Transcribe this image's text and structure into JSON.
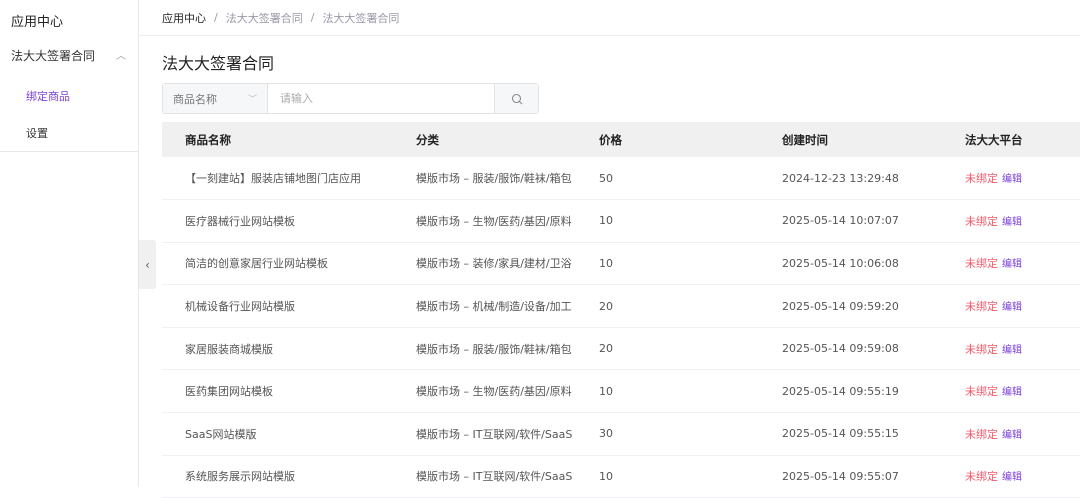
{
  "sidebar": {
    "title": "应用中心",
    "group": "法大大签署合同",
    "items": [
      {
        "label": "绑定商品",
        "active": true
      },
      {
        "label": "设置",
        "active": false
      }
    ]
  },
  "breadcrumb": [
    "应用中心",
    "法大大签署合同",
    "法大大签署合同"
  ],
  "page_title": "法大大签署合同",
  "search": {
    "field": "商品名称",
    "placeholder": "请输入"
  },
  "table": {
    "headers": [
      "商品名称",
      "分类",
      "价格",
      "创建时间",
      "法大大平台"
    ],
    "rows": [
      [
        "【一刻建站】服装店铺地图门店应用",
        "模版市场 – 服装/服饰/鞋袜/箱包",
        "50",
        "2024-12-23 13:29:48",
        "未绑定",
        "编辑"
      ],
      [
        "医疗器械行业网站模板",
        "模版市场 – 生物/医药/基因/原料",
        "10",
        "2025-05-14 10:07:07",
        "未绑定",
        "编辑"
      ],
      [
        "简洁的创意家居行业网站模板",
        "模版市场 – 装修/家具/建材/卫浴",
        "10",
        "2025-05-14 10:06:08",
        "未绑定",
        "编辑"
      ],
      [
        "机械设备行业网站模版",
        "模版市场 – 机械/制造/设备/加工",
        "20",
        "2025-05-14 09:59:20",
        "未绑定",
        "编辑"
      ],
      [
        "家居服装商城模版",
        "模版市场 – 服装/服饰/鞋袜/箱包",
        "20",
        "2025-05-14 09:59:08",
        "未绑定",
        "编辑"
      ],
      [
        "医药集团网站模板",
        "模版市场 – 生物/医药/基因/原料",
        "10",
        "2025-05-14 09:55:19",
        "未绑定",
        "编辑"
      ],
      [
        "SaaS网站模版",
        "模版市场 – IT互联网/软件/SaaS",
        "30",
        "2025-05-14 09:55:15",
        "未绑定",
        "编辑"
      ],
      [
        "系统服务展示网站模版",
        "模版市场 – IT互联网/软件/SaaS",
        "10",
        "2025-05-14 09:55:07",
        "未绑定",
        "编辑"
      ]
    ]
  }
}
